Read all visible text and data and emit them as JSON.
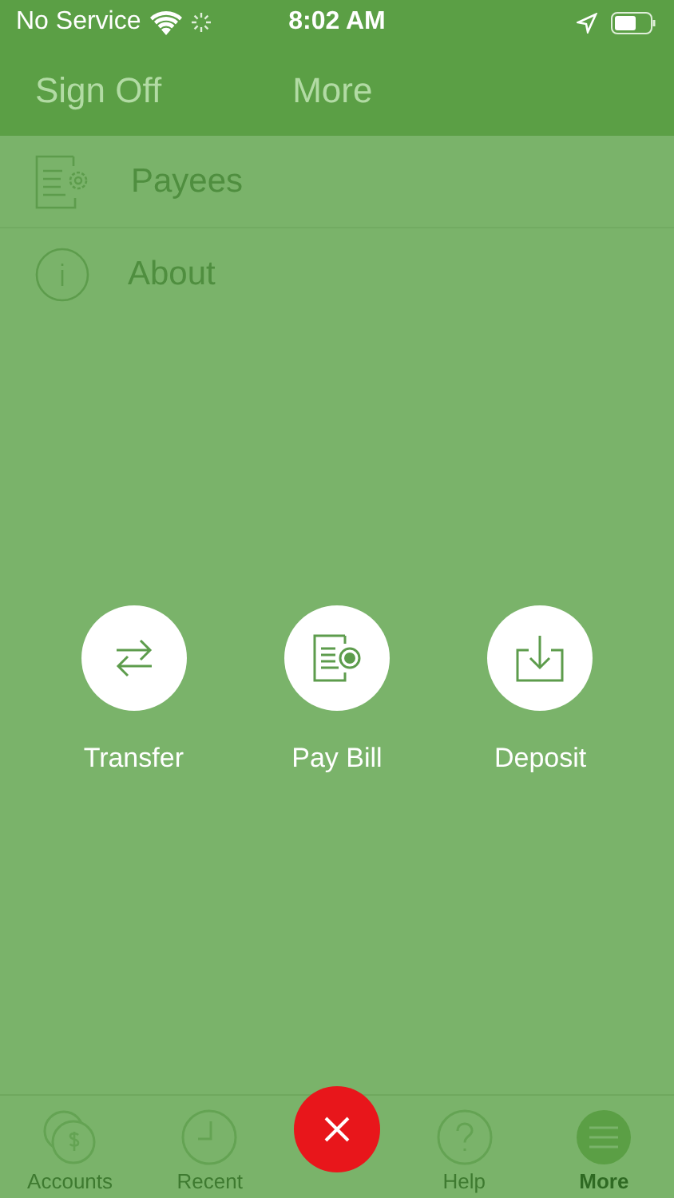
{
  "status_bar": {
    "carrier": "No Service",
    "time": "8:02 AM"
  },
  "header": {
    "left_button": "Sign Off",
    "title": "More"
  },
  "menu": [
    {
      "kind": "payees",
      "label": "Payees"
    },
    {
      "kind": "about",
      "label": "About"
    }
  ],
  "actions": [
    {
      "kind": "transfer",
      "label": "Transfer"
    },
    {
      "kind": "pay-bill",
      "label": "Pay Bill"
    },
    {
      "kind": "deposit",
      "label": "Deposit"
    }
  ],
  "tab_bar": [
    {
      "kind": "accounts",
      "label": "Accounts",
      "selected": false
    },
    {
      "kind": "recent",
      "label": "Recent",
      "selected": false
    },
    {
      "kind": "close"
    },
    {
      "kind": "help",
      "label": "Help",
      "selected": false
    },
    {
      "kind": "more",
      "label": "More",
      "selected": true
    }
  ]
}
